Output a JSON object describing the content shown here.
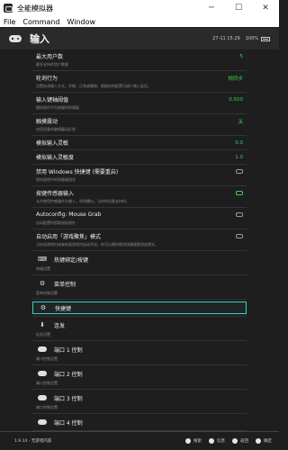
{
  "window": {
    "title": "全能模拟器",
    "minimize": "─",
    "maximize": "☐",
    "close": "✕"
  },
  "menu": [
    "File",
    "Command",
    "Window"
  ],
  "header": {
    "title": "输入",
    "clock": "27-11 15:29",
    "battery": "100%"
  },
  "rows": [
    {
      "label": "最大用户数",
      "value": "5",
      "value_color": "green",
      "sub": "最多支持的用户数量"
    },
    {
      "label": "轮询行为",
      "value": "帧同步",
      "value_color": "green",
      "sub": "设置轮询输入方式，早期、正常或晚期，根据你的配置可减少输入延迟。"
    },
    {
      "label": "输入键轴阈值",
      "value": "0.500",
      "value_color": "green",
      "sub": "模拟摇杆作为按键时的阈值"
    },
    {
      "label": "触摸震动",
      "value": "关",
      "value_color": "green",
      "sub": "启用设备的触摸震动反馈"
    },
    {
      "label": "模拟输入灵敏",
      "value": "0.0",
      "value_color": "green",
      "sub": ""
    },
    {
      "label": "模拟输入灵敏度",
      "value": "1.0",
      "value_color": "green",
      "sub": ""
    },
    {
      "label": "禁用 Windows 快捷键 (需要重启)",
      "value": "toggle-off",
      "value_color": "grey",
      "sub": "保持游戏中的快捷键组合"
    },
    {
      "label": "按键传感器输入",
      "value": "toggle-on",
      "value_color": "green",
      "sub": "允许使用传感器作为输入，如陀螺仪。当你的设备支持时。"
    },
    {
      "label": "Autoconfig: Mouse Grab",
      "value": "toggle-off",
      "value_color": "grey",
      "sub": "自动配置时抓取鼠标指针"
    },
    {
      "label": "自动启用「游戏聚焦」模式",
      "value": "toggle-off",
      "value_color": "grey",
      "sub": "当启动游戏时或者恢复游戏时自动开启，你可以随时使用快捷键更改此模式。"
    }
  ],
  "groups": [
    {
      "icon": "hotkey-icon",
      "glyph": "⌨",
      "label": "热键绑定/按键",
      "sub": "热键设置",
      "selected": false
    },
    {
      "icon": "menu-controls-icon",
      "glyph": "⚙",
      "label": "菜单控制",
      "sub": "菜单控制设置",
      "selected": false
    },
    {
      "icon": "shortcut-icon",
      "glyph": "⚙",
      "label": "快捷键",
      "sub": "",
      "selected": true
    },
    {
      "icon": "turbo-icon",
      "glyph": "⬇",
      "label": "连发",
      "sub": "连发设置",
      "selected": false
    },
    {
      "icon": "gamepad-icon",
      "glyph": "",
      "label": "端口 1 控制",
      "sub": "端口控制设置",
      "selected": false
    },
    {
      "icon": "gamepad-icon",
      "glyph": "",
      "label": "端口 2 控制",
      "sub": "端口控制设置",
      "selected": false
    },
    {
      "icon": "gamepad-icon",
      "glyph": "",
      "label": "端口 3 控制",
      "sub": "端口控制设置",
      "selected": false
    },
    {
      "icon": "gamepad-icon",
      "glyph": "",
      "label": "端口 4 控制",
      "sub": "",
      "selected": false
    }
  ],
  "bottom": {
    "version": "1.9.14 - 无游戏内容",
    "actions": [
      "搜索",
      "信息",
      "返回",
      "确定"
    ]
  }
}
